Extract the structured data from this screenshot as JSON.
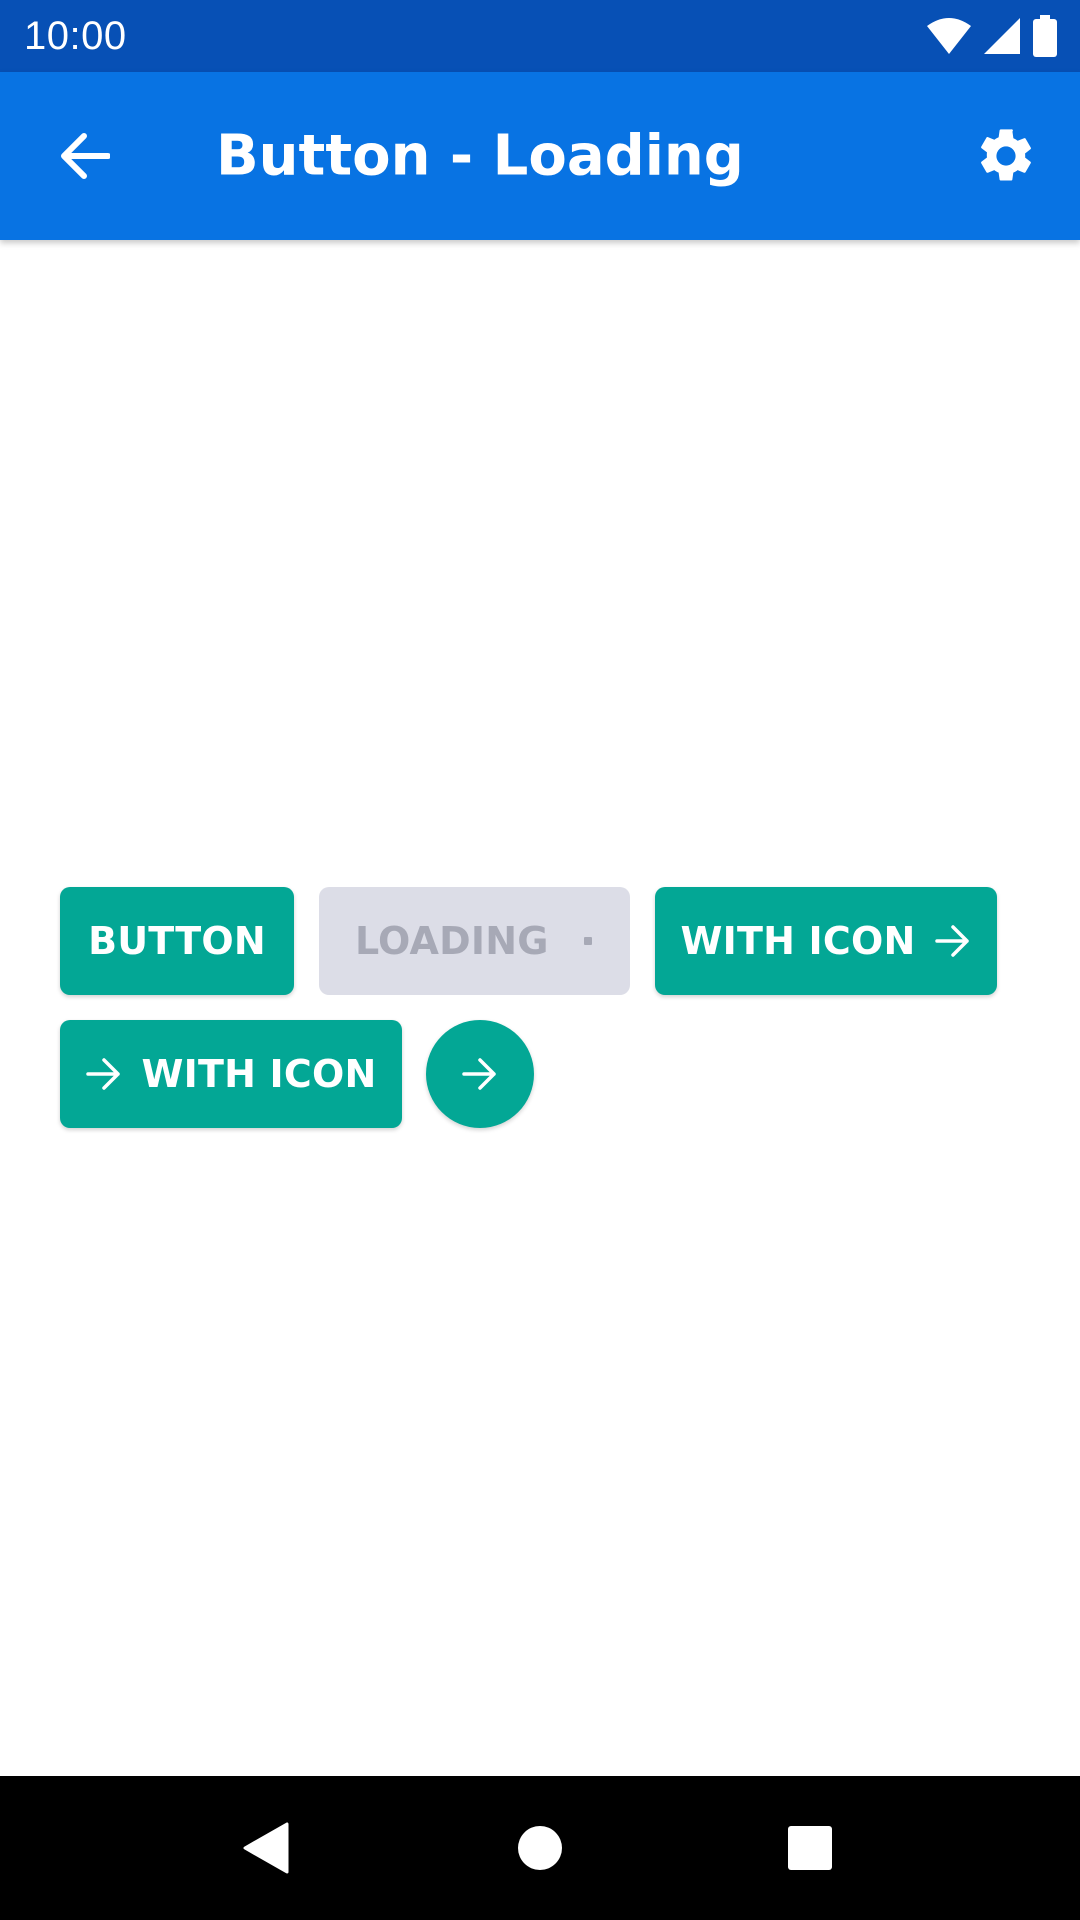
{
  "status_bar": {
    "time": "10:00",
    "background": "#0750b5",
    "icons": [
      "wifi-icon",
      "signal-icon",
      "battery-icon"
    ]
  },
  "app_bar": {
    "title": "Button - Loading",
    "background": "#0873e3",
    "back_icon": "arrow-back-icon",
    "settings_icon": "gear-icon"
  },
  "buttons": {
    "primary_label": "BUTTON",
    "loading_label": "LOADING",
    "icon_right_label": "WITH ICON",
    "icon_left_label": "WITH ICON",
    "round_icon": "arrow-right-icon",
    "colors": {
      "primary": "#03a795",
      "disabled_bg": "#dcdde7",
      "disabled_text": "#a7a9b6"
    }
  },
  "nav_bar": {
    "background": "#000000",
    "icons": [
      "back-triangle-icon",
      "home-circle-icon",
      "recents-square-icon"
    ]
  }
}
